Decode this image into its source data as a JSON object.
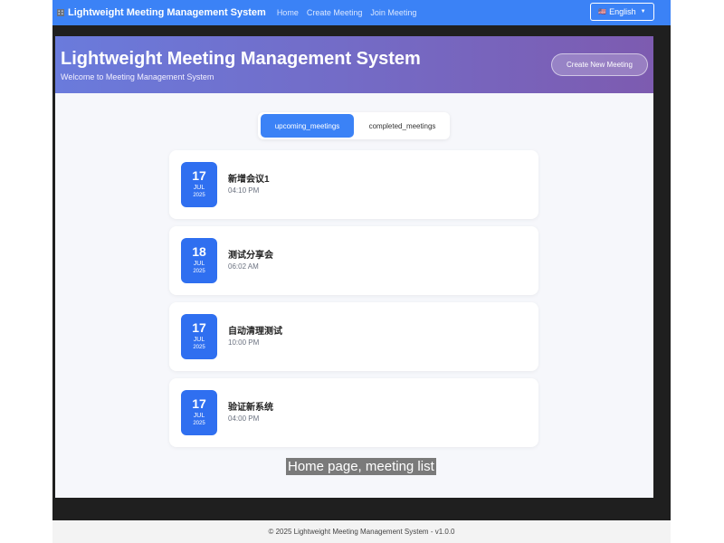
{
  "navbar": {
    "brand": "Lightweight Meeting Management System",
    "links": [
      "Home",
      "Create Meeting",
      "Join Meeting"
    ],
    "language": "English"
  },
  "hero": {
    "title": "Lightweight Meeting Management System",
    "subtitle": "Welcome to Meeting Management System",
    "create_button": "Create New Meeting"
  },
  "tabs": {
    "upcoming": "upcoming_meetings",
    "completed": "completed_meetings",
    "active": "upcoming_meetings"
  },
  "meetings": [
    {
      "day": "17",
      "month": "JUL",
      "year": "2025",
      "title": "新增会议1",
      "time": "04:10 PM"
    },
    {
      "day": "18",
      "month": "JUL",
      "year": "2025",
      "title": "测试分享会",
      "time": "06:02 AM"
    },
    {
      "day": "17",
      "month": "JUL",
      "year": "2025",
      "title": "自动清理测试",
      "time": "10:00 PM"
    },
    {
      "day": "17",
      "month": "JUL",
      "year": "2025",
      "title": "验证新系统",
      "time": "04:00 PM"
    }
  ],
  "caption": "Home page, meeting list",
  "footer": "© 2025 Lightweight Meeting Management System - v1.0.0",
  "colors": {
    "primary": "#3b82f6",
    "hero_start": "#6a7bdc",
    "hero_end": "#7d5bb0"
  }
}
